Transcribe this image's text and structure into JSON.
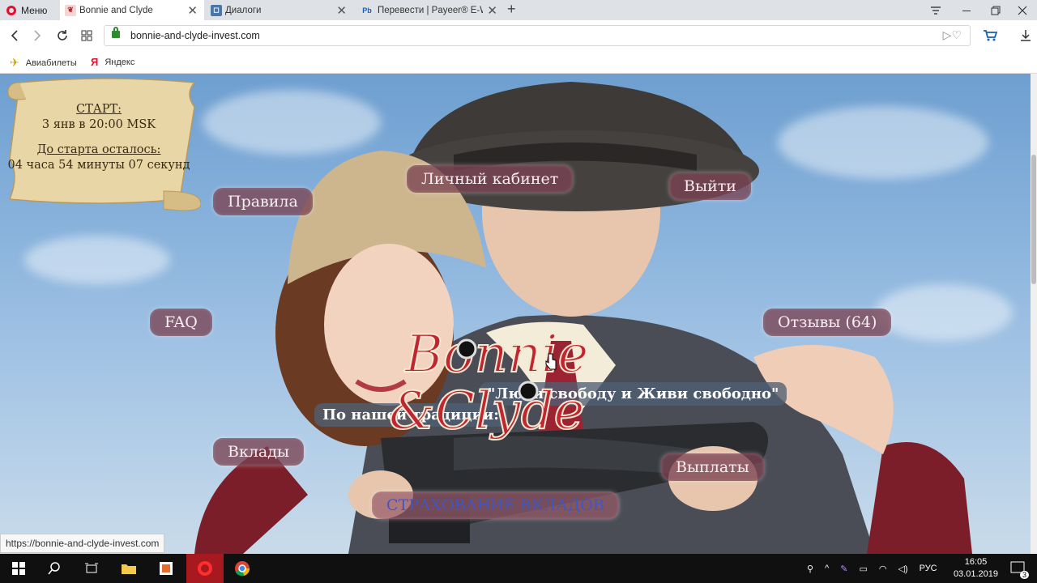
{
  "browser": {
    "menu_label": "Меню",
    "tabs": [
      {
        "title": "Bonnie and Clyde",
        "favicon": "bc-favicon"
      },
      {
        "title": "Диалоги",
        "favicon": "vk-favicon"
      },
      {
        "title": "Перевести | Payeer® E-W",
        "favicon": "payeer-favicon",
        "favicon_text": "Pb"
      }
    ],
    "url": "bonnie-and-clyde-invest.com",
    "bookmarks": [
      {
        "label": "Авиабилеты",
        "icon": "plane-icon"
      },
      {
        "label": "Яндекс",
        "icon": "yandex-icon",
        "icon_text": "Я"
      }
    ],
    "status_url": "https://bonnie-and-clyde-invest.com"
  },
  "page": {
    "countdown": {
      "start_label": "СТАРТ:",
      "start_value": "3 янв в 20:00 MSK",
      "remaining_label": "До старта осталось:",
      "remaining_value": "04 часа  54 минуты 07 секунд"
    },
    "nav": {
      "cabinet": "Личный кабинет",
      "logout": "Выйти",
      "rules": "Правила",
      "faq": "FAQ",
      "reviews": "Отзывы (64)",
      "deposits": "Вклады",
      "payouts": "Выплаты",
      "insurance": "СТРАХОВАНИЕ ВКЛАДОВ"
    },
    "tradition": "По нашей традиции:",
    "motto": "\"Люби свободу и Живи свободно\"",
    "logo_line1": "Bonnie",
    "logo_line2": "&Clyde"
  },
  "taskbar": {
    "lang": "РУС",
    "time": "16:05",
    "date": "03.01.2019",
    "notifications": "3"
  },
  "colors": {
    "accent": "#e2102d",
    "pill": "#7a4252",
    "sky": "#8bb4dd"
  }
}
